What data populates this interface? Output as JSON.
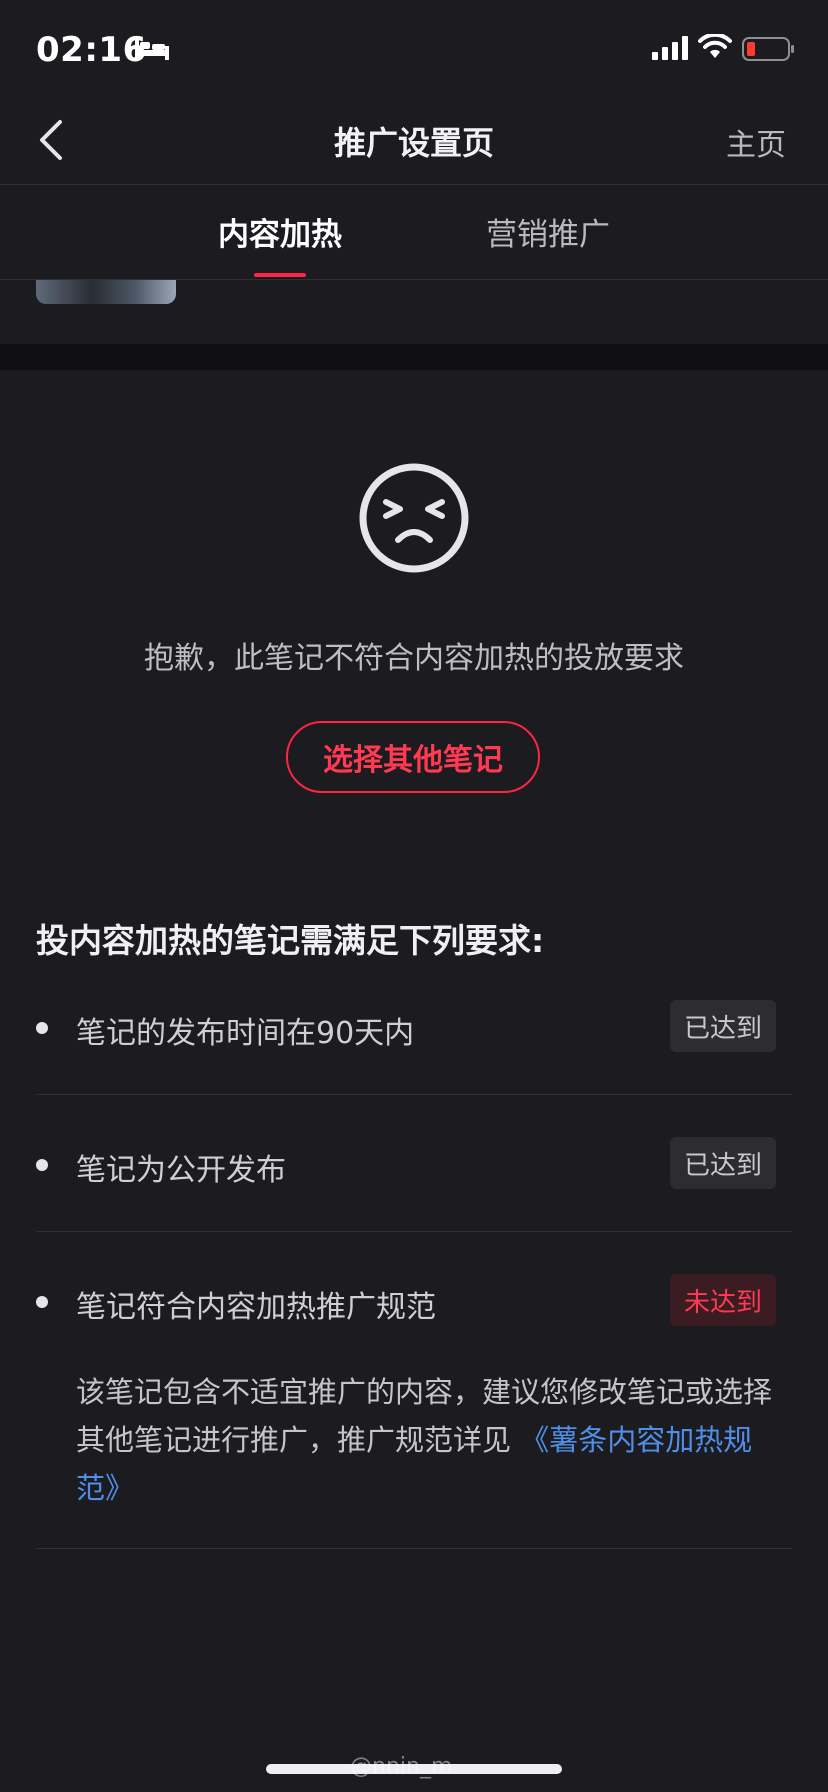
{
  "status_bar": {
    "time": "02:16"
  },
  "nav": {
    "title": "推广设置页",
    "home_label": "主页"
  },
  "tabs": [
    {
      "label": "内容加热",
      "active": true
    },
    {
      "label": "营销推广",
      "active": false
    }
  ],
  "message": {
    "sorry_text": "抱歉，此笔记不符合内容加热的投放要求",
    "choose_button": "选择其他笔记"
  },
  "requirements": {
    "heading": "投内容加热的笔记需满足下列要求:",
    "items": [
      {
        "text": "笔记的发布时间在90天内",
        "status": "已达到",
        "met": true
      },
      {
        "text": "笔记为公开发布",
        "status": "已达到",
        "met": true
      },
      {
        "text": "笔记符合内容加热推广规范",
        "status": "未达到",
        "met": false
      }
    ],
    "detail_text": "该笔记包含不适宜推广的内容，建议您修改笔记或选择其他笔记进行推广，推广规范详见",
    "detail_link": "《薯条内容加热规范》"
  },
  "watermark": "@nnin_m",
  "colors": {
    "accent": "#ff2442",
    "link": "#4f8fe8",
    "background": "#1b1b20"
  }
}
